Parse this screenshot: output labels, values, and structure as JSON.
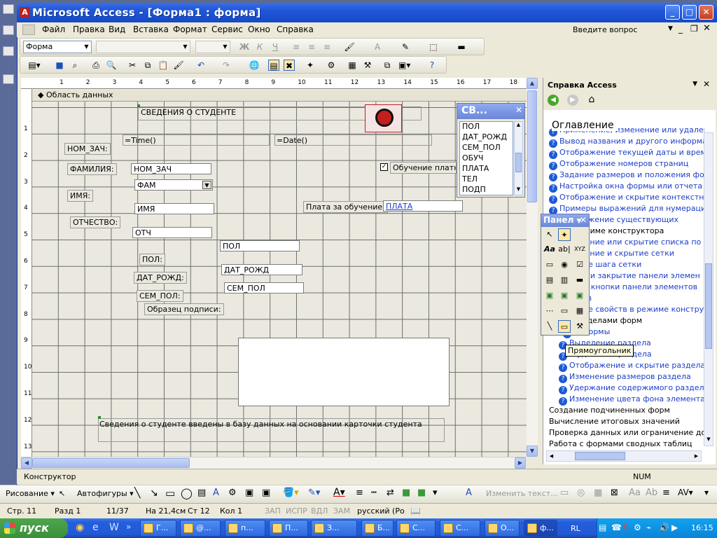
{
  "title": "Microsoft Access - [Форма1 : форма]",
  "menu": [
    "Файл",
    "Правка",
    "Вид",
    "Вставка",
    "Формат",
    "Сервис",
    "Окно",
    "Справка"
  ],
  "ask_placeholder": "Введите вопрос",
  "format_toolbar": {
    "object_combo": "Форма"
  },
  "section_header": "Область данных",
  "ruler_numbers": [
    "1",
    "2",
    "3",
    "4",
    "5",
    "6",
    "7",
    "8",
    "9",
    "10",
    "11",
    "12",
    "13",
    "14",
    "15",
    "16",
    "17",
    "18"
  ],
  "ruler_left_numbers": [
    "1",
    "2",
    "3",
    "4",
    "5",
    "6",
    "7",
    "8",
    "9",
    "10",
    "11",
    "12",
    "13"
  ],
  "form": {
    "title_text": "СВЕДЕНИЯ О СТУДЕНТЕ",
    "time_field": "=Time()",
    "date_field": "=Date()",
    "labels": {
      "nom_zach": "НОМ_ЗАЧ:",
      "familia": "ФАМИЛИЯ:",
      "imya": "ИМЯ:",
      "otchestvo": "ОТЧЕСТВО:",
      "pol": "ПОЛ:",
      "dat_rozhd": "ДАТ_РОЖД:",
      "sem_pol": "СЕМ_ПОЛ:",
      "obrazec": "Образец подписи:",
      "plata": "Плата за обучение:",
      "obuchenie": "Обучение платно"
    },
    "fields": {
      "nom_zach": "НОМ_ЗАЧ",
      "fam": "ФАМ",
      "imya": "ИМЯ",
      "otch": "ОТЧ",
      "pol": "ПОЛ",
      "dat_rozhd": "ДАТ_РОЖД",
      "sem_pol": "СЕМ_ПОЛ",
      "plata": "ПЛАТА"
    },
    "footer_text": "Сведения о студенте введены в базу данных на основании карточки студента"
  },
  "field_list": {
    "title": "СВ...",
    "items": [
      "ПОЛ",
      "ДАТ_РОЖД",
      "СЕМ_ПОЛ",
      "ОБУЧ",
      "ПЛАТА",
      "ТЕЛ",
      "ПОДП"
    ]
  },
  "toolbox": {
    "title": "Панел",
    "tooltip": "Прямоугольник"
  },
  "help": {
    "title": "Справка Access",
    "heading": "Оглавление",
    "items": [
      {
        "text": "Применение, изменение или удаление",
        "link": true
      },
      {
        "text": "Вывод названия и другого информации",
        "link": true
      },
      {
        "text": "Отображение текущей даты и времени",
        "link": true
      },
      {
        "text": "Отображение номеров страниц",
        "link": true
      },
      {
        "text": "Задание размеров и положения формы и",
        "link": true
      },
      {
        "text": "Настройка окна формы или отчета",
        "link": true
      },
      {
        "text": "Отображение и скрытие контекстного ме",
        "link": true
      },
      {
        "text": "Примеры выражений для нумерации стр",
        "link": true
      },
      {
        "text": "отображение существующих",
        "link": true
      },
      {
        "text": "режиме конструктора",
        "link": false
      },
      {
        "text": "ажение или скрытие списка по",
        "link": true
      },
      {
        "text": "ажение и скрытие сетки",
        "link": true
      },
      {
        "text": "ение шага сетки",
        "link": true
      },
      {
        "text": "тие и закрытие панели элемен",
        "link": true
      },
      {
        "text": "ция кнопки панели элементов",
        "link": true
      },
      {
        "text": "йств",
        "link": true
      },
      {
        "text": "ение свойств в режиме конструкт",
        "link": true
      },
      {
        "text": "разделами форм",
        "link": false
      },
      {
        "text": "ы формы",
        "link": true
      },
      {
        "text": "Выделение раздела",
        "link": true
      },
      {
        "text": "и удаление раздела",
        "link": true
      },
      {
        "text": "Отображение и скрытие раздела",
        "link": true
      },
      {
        "text": "Изменение размеров раздела",
        "link": true
      },
      {
        "text": "Удержание содержимого раздела в о",
        "link": true
      },
      {
        "text": "Изменение цвета фона элемента упра",
        "link": true
      }
    ],
    "plain_items": [
      "Создание подчиненных форм",
      "Вычисление итоговых значений",
      "Проверка данных или ограничение доступ",
      "Работа с формами сводных таблиц"
    ]
  },
  "status": {
    "mode": "Конструктор",
    "num": "NUM"
  },
  "drawbar": {
    "risovanie": "Рисование",
    "avtofigury": "Автофигуры",
    "izm_text": "Изменить текст..."
  },
  "word_status": {
    "page": "Стр. 11",
    "section": "Разд 1",
    "pages": "11/37",
    "pos": "На 21,4см",
    "line": "Ст 12",
    "col": "Кол 1",
    "zap": "ЗАП",
    "ispr": "ИСПР",
    "vdl": "ВДЛ",
    "zam": "ЗАМ",
    "lang": "русский (Ро"
  },
  "taskbar": {
    "start": "пуск",
    "buttons": [
      "Г...",
      "@...",
      "п...",
      "П...",
      "З...",
      "Б...",
      "С...",
      "С...",
      "О...",
      "ф..."
    ],
    "lang": "RL",
    "time": "16:15"
  }
}
